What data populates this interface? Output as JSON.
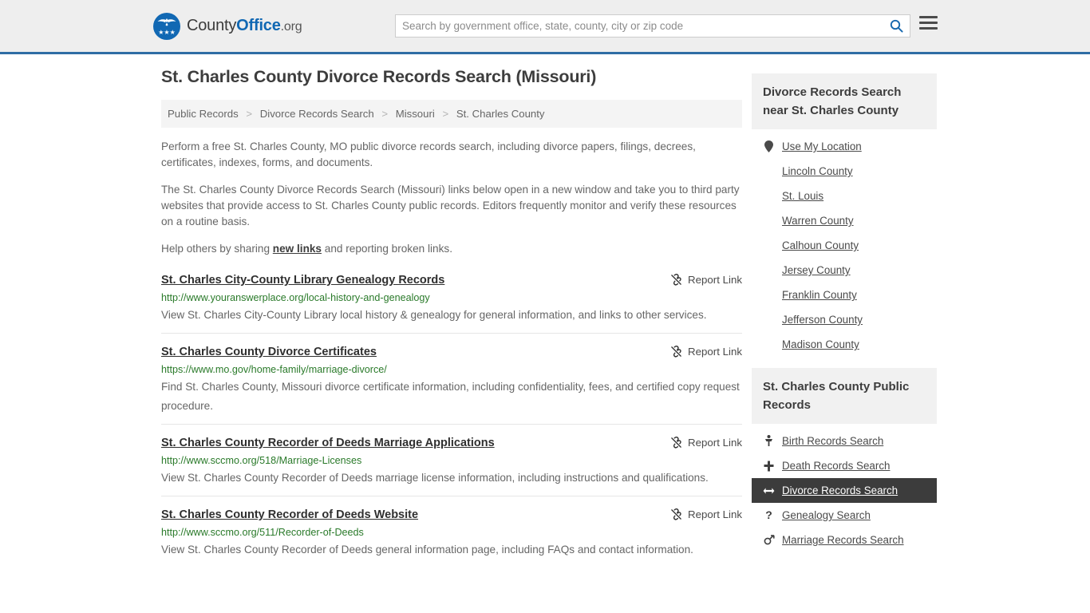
{
  "header": {
    "brand": {
      "part1": "County",
      "part2": "Office",
      "part3": ".org",
      "logo_icon": "eagle-seal-icon",
      "stars": "★★★"
    },
    "search": {
      "placeholder": "Search by government office, state, county, city or zip code",
      "value": "",
      "search_icon": "search-icon"
    },
    "menu_icon": "hamburger-menu-icon"
  },
  "main": {
    "title": "St. Charles County Divorce Records Search (Missouri)",
    "breadcrumb": [
      "Public Records",
      "Divorce Records Search",
      "Missouri",
      "St. Charles County"
    ],
    "breadcrumb_separator": ">",
    "intro_1": "Perform a free St. Charles County, MO public divorce records search, including divorce papers, filings, decrees, certificates, indexes, forms, and documents.",
    "intro_2": "The St. Charles County Divorce Records Search (Missouri) links below open in a new window and take you to third party websites that provide access to St. Charles County public records. Editors frequently monitor and verify these resources on a routine basis.",
    "intro_3_before": "Help others by sharing ",
    "intro_3_link": "new links",
    "intro_3_after": " and reporting broken links.",
    "report_label": "Report Link",
    "report_icon": "broken-link-icon",
    "results": [
      {
        "title": "St. Charles City-County Library Genealogy Records",
        "url": "http://www.youranswerplace.org/local-history-and-genealogy",
        "description": "View St. Charles City-County Library local history & genealogy for general information, and links to other services."
      },
      {
        "title": "St. Charles County Divorce Certificates",
        "url": "https://www.mo.gov/home-family/marriage-divorce/",
        "description": "Find St. Charles County, Missouri divorce certificate information, including confidentiality, fees, and certified copy request procedure."
      },
      {
        "title": "St. Charles County Recorder of Deeds Marriage Applications",
        "url": "http://www.sccmo.org/518/Marriage-Licenses",
        "description": "View St. Charles County Recorder of Deeds marriage license information, including instructions and qualifications."
      },
      {
        "title": "St. Charles County Recorder of Deeds Website",
        "url": "http://www.sccmo.org/511/Recorder-of-Deeds",
        "description": "View St. Charles County Recorder of Deeds general information page, including FAQs and contact information."
      }
    ]
  },
  "sidebar": {
    "nearby": {
      "heading": "Divorce Records Search near St. Charles County",
      "items": [
        {
          "label": "Use My Location",
          "icon": "map-pin-icon"
        },
        {
          "label": "Lincoln County",
          "icon": ""
        },
        {
          "label": "St. Louis",
          "icon": ""
        },
        {
          "label": "Warren County",
          "icon": ""
        },
        {
          "label": "Calhoun County",
          "icon": ""
        },
        {
          "label": "Jersey County",
          "icon": ""
        },
        {
          "label": "Franklin County",
          "icon": ""
        },
        {
          "label": "Jefferson County",
          "icon": ""
        },
        {
          "label": "Madison County",
          "icon": ""
        }
      ]
    },
    "public_records": {
      "heading": "St. Charles County Public Records",
      "items": [
        {
          "label": "Birth Records Search",
          "icon": "baby-icon",
          "glyph": "Ὤ8",
          "active": false
        },
        {
          "label": "Death Records Search",
          "icon": "cross-icon",
          "glyph": "+",
          "active": false
        },
        {
          "label": "Divorce Records Search",
          "icon": "arrows-split-icon",
          "glyph": "↔",
          "active": true
        },
        {
          "label": "Genealogy Search",
          "icon": "question-mark-icon",
          "glyph": "?",
          "active": false
        },
        {
          "label": "Marriage Records Search",
          "icon": "male-female-icon",
          "glyph": "⚥",
          "active": false
        }
      ]
    }
  },
  "colors": {
    "brand_blue": "#1168b3",
    "header_border": "#2f6da4",
    "header_bg": "#eeeeee",
    "url_green": "#2a7a2a",
    "active_bg": "#3c3c3c"
  }
}
